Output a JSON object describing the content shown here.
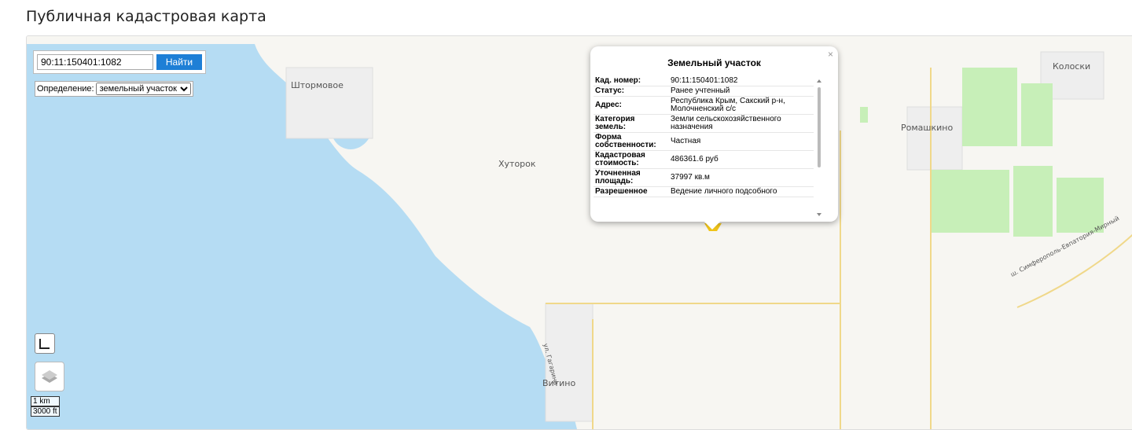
{
  "page": {
    "title": "Публичная кадастровая карта"
  },
  "search": {
    "value": "90:11:150401:1082",
    "button_label": "Найти"
  },
  "definition": {
    "label": "Определение:",
    "selected": "земельный участок"
  },
  "map_labels": [
    "Штормовое",
    "Хуторок",
    "Ромашкино",
    "Колоски",
    "Витино",
    "ш. Симферополь-Евпатория-Мирный",
    "ул. Гагарина"
  ],
  "scale": {
    "metric": "1 km",
    "imperial": "3000 ft"
  },
  "popup": {
    "title": "Земельный участок",
    "close": "×",
    "rows": [
      {
        "key": "Кад. номер:",
        "value": "90:11:150401:1082"
      },
      {
        "key": "Статус:",
        "value": "Ранее учтенный"
      },
      {
        "key": "Адрес:",
        "value": "Республика Крым, Сакский р-н, Молочненский с/с"
      },
      {
        "key": "Категория земель:",
        "value": "Земли сельскохозяйственного назначения"
      },
      {
        "key": "Форма собственности:",
        "value": "Частная"
      },
      {
        "key": "Кадастровая стоимость:",
        "value": "486361.6 руб"
      },
      {
        "key": "Уточненная площадь:",
        "value": "37997 кв.м"
      },
      {
        "key": "Разрешенное",
        "value": "Ведение личного подсобного"
      }
    ]
  },
  "colors": {
    "water": "#b5dcf3",
    "fields": "#c7efb8",
    "roads": "#f0d88a",
    "button": "#1e7fd6"
  }
}
